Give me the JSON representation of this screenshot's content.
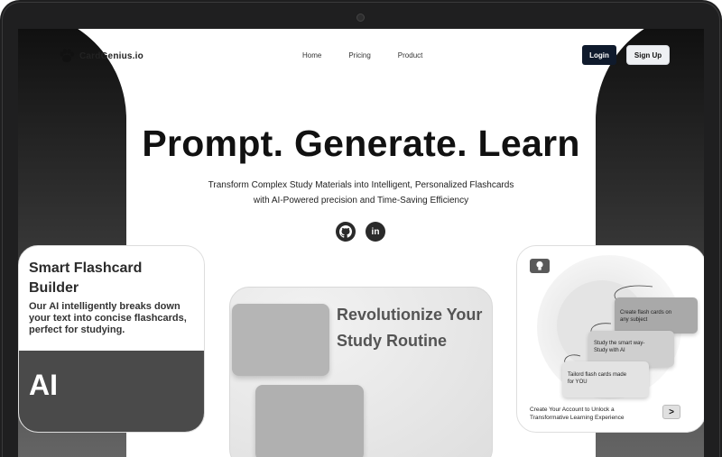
{
  "brand": {
    "name": "CardGenius.io",
    "logo_icon": "paw-logo-icon"
  },
  "nav": {
    "links": [
      "Home",
      "Pricing",
      "Product"
    ],
    "login_label": "Login",
    "signup_label": "Sign Up"
  },
  "hero": {
    "title": "Prompt. Generate. Learn",
    "subtitle_line1": "Transform Complex Study Materials into Intelligent, Personalized Flashcards",
    "subtitle_line2": "with AI-Powered precision and Time-Saving Efficiency",
    "social_icons": [
      "github-icon",
      "linkedin-icon"
    ],
    "linkedin_glyph": "in"
  },
  "cards": {
    "flashcard": {
      "title_line1": "Smart Flashcard",
      "title_line2": "Builder",
      "desc_line1": "Our AI intelligently breaks down",
      "desc_line2": "your text into concise flashcards,",
      "desc_line3": "perfect for studying.",
      "badge": "AI"
    },
    "routine": {
      "title_line1": "Revolutionize Your",
      "title_line2": "Study Routine"
    },
    "account": {
      "bubble1_line1": "Create flash cards on",
      "bubble1_line2": "any subject",
      "bubble2_line1": "Study the smart way-",
      "bubble2_line2": "Study with AI",
      "bubble3_line1": "Tailord flash cards made",
      "bubble3_line2": "for YOU",
      "cta_line1": "Create Your Account to Unlock a",
      "cta_line2": "Transformative Learning Experience",
      "arrow": ">"
    }
  },
  "colors": {
    "primary_dark": "#0f1a2c",
    "frame": "#1f1f20",
    "card_band": "#4a4a4a"
  }
}
